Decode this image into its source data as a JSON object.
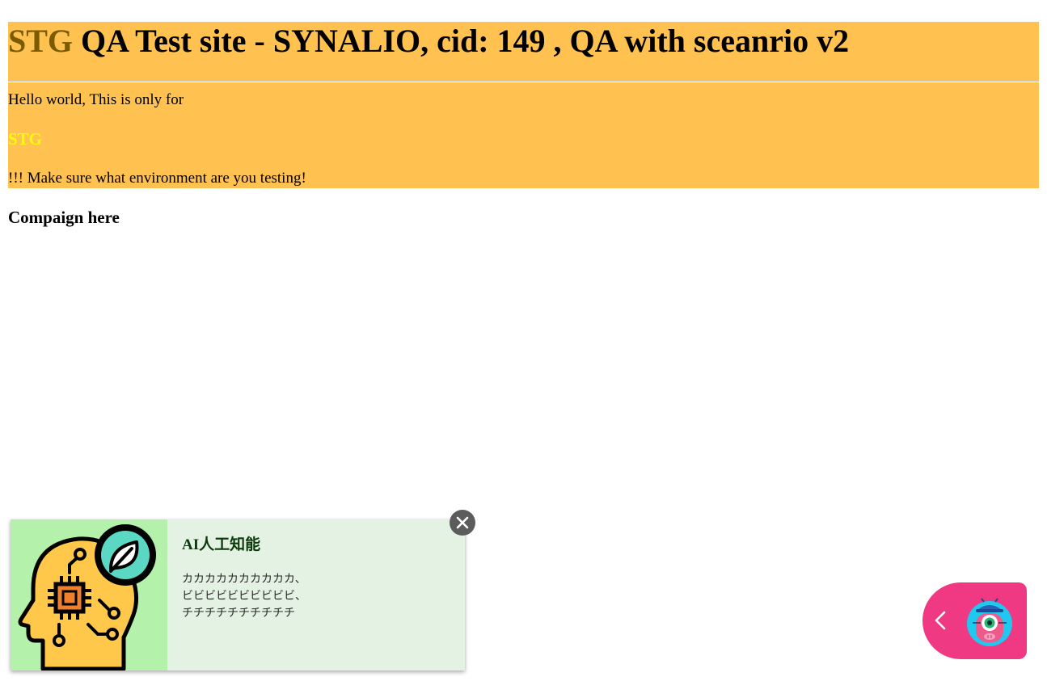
{
  "header": {
    "env_tag": "STG",
    "title_rest": " QA Test site - SYNALIO, cid: 149 , QA with sceanrio v2"
  },
  "banner": {
    "hello_text": "Hello world, This is only for",
    "env_badge": "STG",
    "warning_text": "!!! Make sure what environment are you testing!"
  },
  "campaign": {
    "heading": "Compaign here"
  },
  "popup": {
    "title": "AI人工知能",
    "lines": [
      "カカカカカカカカカカ、",
      "ビビビビビビビビビビ、",
      "チチチチチチチチチチ"
    ],
    "image_icon": "ai-head-circuit-icon",
    "close_icon": "close-icon"
  },
  "bot_launcher": {
    "chevron_icon": "chevron-left-icon",
    "avatar_icon": "robot-avatar-icon"
  },
  "colors": {
    "banner_bg": "#ffc250",
    "env_tag_title": "#7a5b00",
    "env_badge": "#ffff00",
    "popup_bg": "#e3f2e3",
    "popup_image_bg": "#b4f2ab",
    "popup_title": "#0b3b0b",
    "bot_launcher_bg": "#ef3a83"
  }
}
